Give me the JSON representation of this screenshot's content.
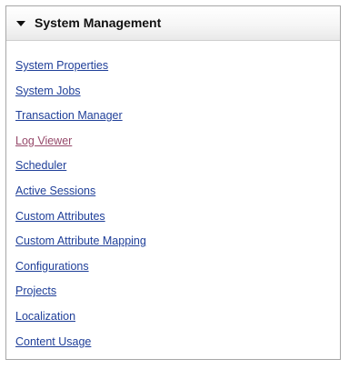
{
  "panel": {
    "title": "System Management",
    "expanded_icon": "triangle-down-icon",
    "items": [
      {
        "label": "System Properties",
        "visited": false
      },
      {
        "label": "System Jobs",
        "visited": false
      },
      {
        "label": "Transaction Manager",
        "visited": false
      },
      {
        "label": "Log Viewer",
        "visited": true
      },
      {
        "label": "Scheduler",
        "visited": false
      },
      {
        "label": "Active Sessions",
        "visited": false
      },
      {
        "label": "Custom Attributes",
        "visited": false
      },
      {
        "label": "Custom Attribute Mapping",
        "visited": false
      },
      {
        "label": "Configurations",
        "visited": false
      },
      {
        "label": "Projects",
        "visited": false
      },
      {
        "label": "Localization",
        "visited": false
      },
      {
        "label": "Content Usage",
        "visited": false
      }
    ]
  },
  "colors": {
    "link": "#1f3f99",
    "visited_link": "#96496a",
    "border": "#a7a7a7"
  }
}
